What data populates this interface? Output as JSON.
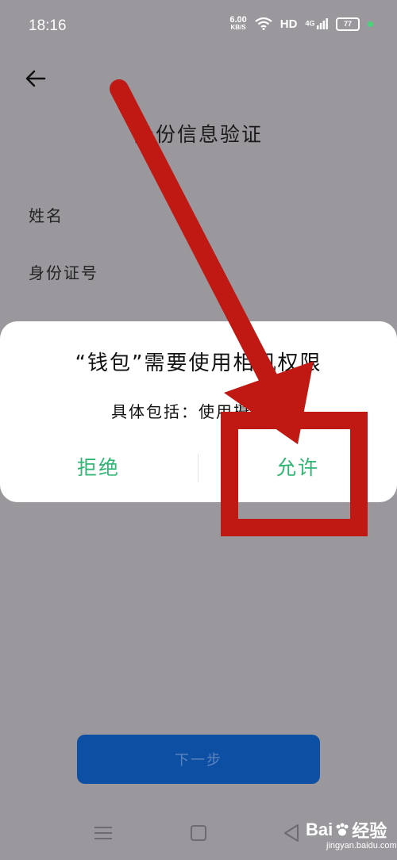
{
  "status_bar": {
    "time": "18:16",
    "speed_value": "6.00",
    "speed_unit": "KB/S",
    "hd_label": "HD",
    "network_label": "4G",
    "battery_level": "77"
  },
  "page": {
    "title": "身份信息验证",
    "fields": [
      {
        "label": "姓名"
      },
      {
        "label": "身份证号"
      }
    ],
    "next_button_label": "下一步"
  },
  "dialog": {
    "title": "“钱包”需要使用相机权限",
    "description": "具体包括：使用摄像头",
    "deny_label": "拒绝",
    "allow_label": "允许"
  },
  "watermark": {
    "brand": "Bai",
    "brand_suffix": "经验",
    "site": "jingyan.baidu.com"
  },
  "colors": {
    "dim_background": "#9a979d",
    "accent_green": "#2fb673",
    "next_button": "#0d4fa3",
    "annotation_red": "#c01812"
  }
}
